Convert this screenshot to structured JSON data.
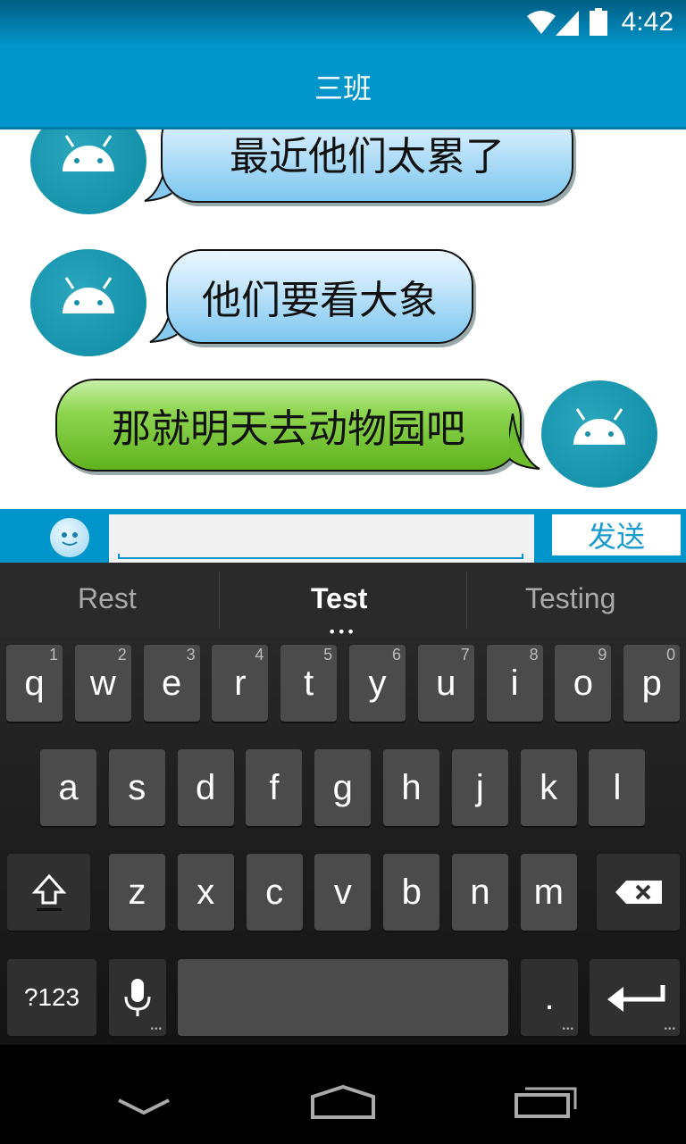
{
  "status_bar": {
    "time": "4:42"
  },
  "title_bar": {
    "title": "三班"
  },
  "chat": {
    "messages": [
      {
        "text": "最近他们太累了",
        "side": "left",
        "color": "blue"
      },
      {
        "text": "他们要看大象",
        "side": "left",
        "color": "blue"
      },
      {
        "text": "那就明天去动物园吧",
        "side": "right",
        "color": "green"
      }
    ]
  },
  "input_bar": {
    "value": "",
    "send_label": "发送"
  },
  "keyboard": {
    "suggestions": [
      "Rest",
      "Test",
      "Testing"
    ],
    "row1": [
      {
        "k": "q",
        "h": "1"
      },
      {
        "k": "w",
        "h": "2"
      },
      {
        "k": "e",
        "h": "3"
      },
      {
        "k": "r",
        "h": "4"
      },
      {
        "k": "t",
        "h": "5"
      },
      {
        "k": "y",
        "h": "6"
      },
      {
        "k": "u",
        "h": "7"
      },
      {
        "k": "i",
        "h": "8"
      },
      {
        "k": "o",
        "h": "9"
      },
      {
        "k": "p",
        "h": "0"
      }
    ],
    "row2": [
      "a",
      "s",
      "d",
      "f",
      "g",
      "h",
      "j",
      "k",
      "l"
    ],
    "row3": [
      "z",
      "x",
      "c",
      "v",
      "b",
      "n",
      "m"
    ],
    "symbols_label": "?123",
    "period_label": "."
  },
  "colors": {
    "accent": "#0096cc",
    "status_bar": "#005f84",
    "send_text": "#1a9bd0"
  }
}
